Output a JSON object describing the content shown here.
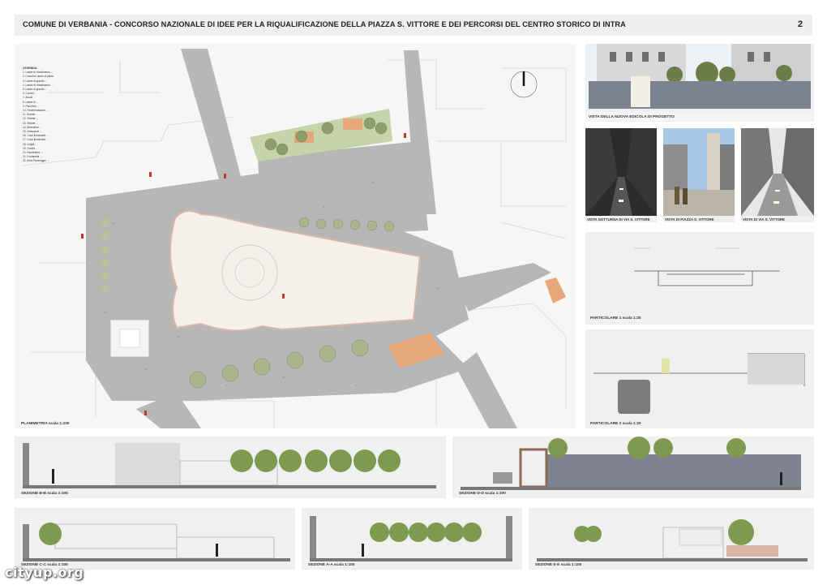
{
  "header": {
    "title": "COMUNE DI VERBANIA - CONCORSO NAZIONALE DI IDEE PER LA RIQUALIFICAZIONE DELLA PIAZZA S. VITTORE E DEI PERCORSI DEL CENTRO STORICO DI INTRA",
    "page_number": "2"
  },
  "plan": {
    "caption": "PLANIMETRIA   scala 1:200",
    "legend_heading": "LEGENDA",
    "legend": [
      "1. Lastre di rivestimento...",
      "2. Cordoli in lastre di pietra",
      "3. Lastre di granito ...",
      "4. Lastre di rivestimento ...",
      "5. Lastre di granito ...",
      "6. Cordoli ...",
      "7. Aiuole",
      "8. Lastre di ...",
      "9. Panchine ...",
      "10. Pavimentazione ...",
      "11. Sedute ...",
      "12. Sedute ...",
      "13. Sedute ...",
      "14. Alberature ...",
      "15. Dissuasori ...",
      "16. Corpi illuminanti ...",
      "17. Corpi illuminanti ...",
      "18. Griglie ...",
      "19. Cestini ...",
      "20. Rastrelliere ...",
      "21. Fontanella ...",
      "22. Area Parcheggio ..."
    ]
  },
  "right_panels": {
    "edicola_caption": "VISTA DELLA NUOVA EDICOLA DI PROGETTO",
    "view1_caption": "VISTA NOTTURNA DI VIA S. VITTORE",
    "view2_caption": "VISTA DI PIAZZA S. VITTORE",
    "view3_caption": "VISTA DI VIA S. VITTORE",
    "detail1_caption": "PARTICOLARE 1   scala 1:20",
    "detail2_caption": "PARTICOLARE 2   scala 1:20"
  },
  "sections": {
    "bb": "SEZIONE B-B   scala 1:100",
    "dd": "SEZIONE D-D   scala 1:100",
    "cc": "SEZIONE C-C   scala 1:100",
    "aa": "SEZIONE A-A   scala 1:100",
    "ee": "SEZIONE E-E   scala 1:100"
  },
  "watermark": "cityup.org",
  "colors": {
    "paving": "#b4b4b4",
    "church": "#f5f0ea",
    "church_outline": "#d9b7a6",
    "green": "#c7d3a8",
    "terracotta": "#e6a77a",
    "panel_bg": "#f0f0f0",
    "tree": "#8c9e6c"
  }
}
